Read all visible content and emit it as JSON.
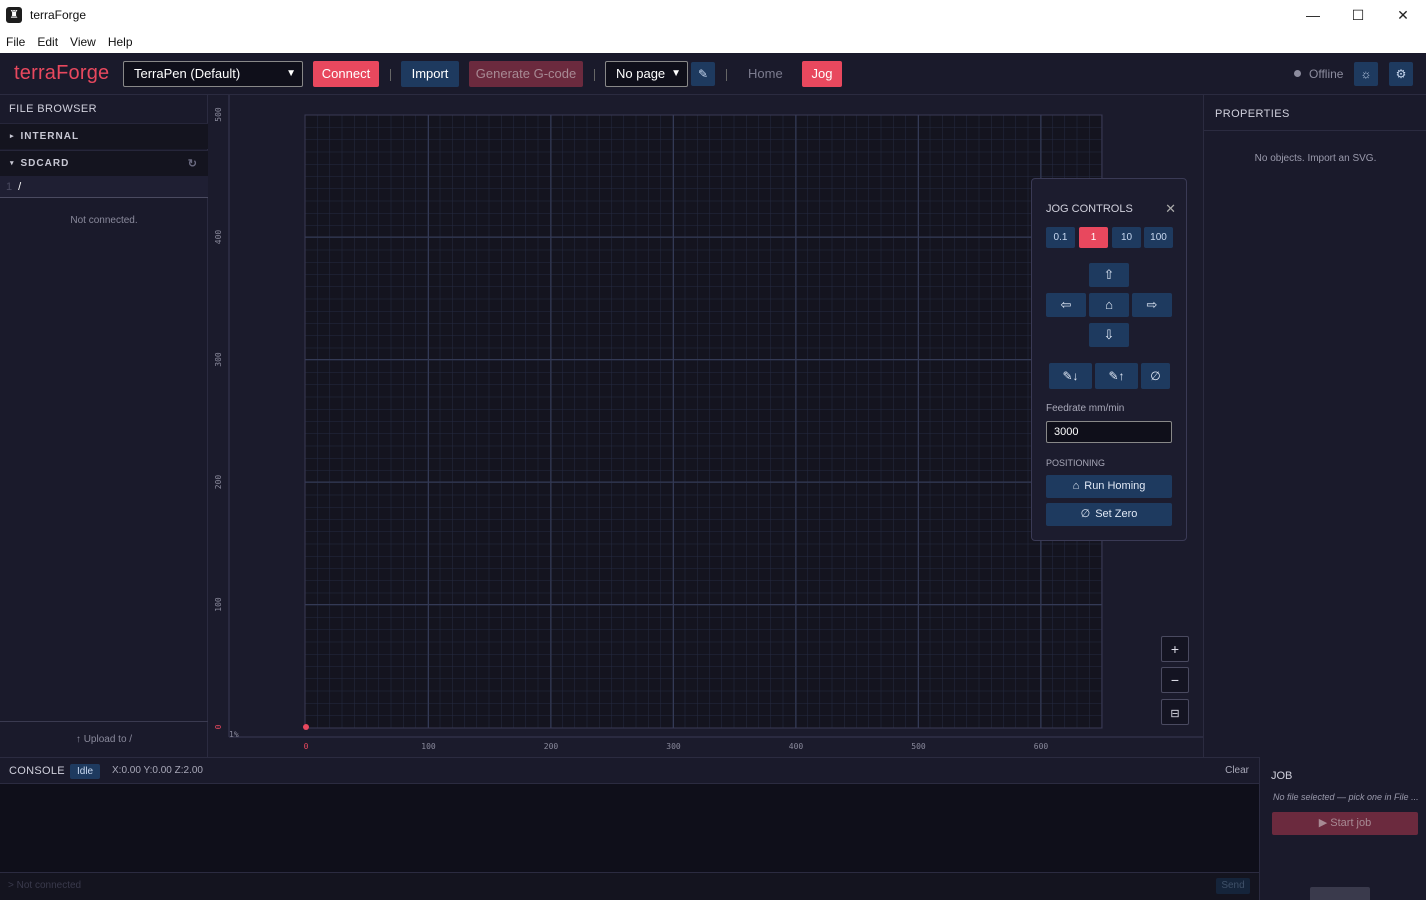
{
  "window": {
    "title": "terraForge",
    "minimize": "—",
    "maximize": "☐",
    "close": "✕"
  },
  "menu": [
    "File",
    "Edit",
    "View",
    "Help"
  ],
  "toolbar": {
    "logo": "terraForge",
    "machine_select": "TerraPen (Default)",
    "connect": "Connect",
    "import": "Import",
    "generate": "Generate G-code",
    "page_select": "No page",
    "home": "Home",
    "jog": "Jog",
    "status": "Offline"
  },
  "file_browser": {
    "title": "FILE BROWSER",
    "internal": "INTERNAL",
    "sdcard": "SDCARD",
    "path_index": "1",
    "path": "/",
    "empty": "Not connected.",
    "upload": "↑ Upload to /"
  },
  "canvas": {
    "x_ticks": [
      "0",
      "100",
      "200",
      "300",
      "400",
      "500",
      "600"
    ],
    "y_ticks": [
      "500",
      "400",
      "300",
      "200",
      "100",
      "0"
    ],
    "zoom_label": "1%"
  },
  "properties": {
    "title": "PROPERTIES",
    "empty": "No objects. Import an SVG."
  },
  "jog": {
    "title": "JOG CONTROLS",
    "steps": [
      "0.1",
      "1",
      "10",
      "100"
    ],
    "active_step": "1",
    "feedrate_label": "Feedrate mm/min",
    "feedrate": "3000",
    "positioning_label": "POSITIONING",
    "run_homing": "Run Homing",
    "set_zero": "Set Zero"
  },
  "console": {
    "title": "CONSOLE",
    "state": "Idle",
    "coords": "X:0.00 Y:0.00 Z:2.00",
    "clear": "Clear",
    "input_placeholder": "> Not connected",
    "send": "Send"
  },
  "job": {
    "title": "JOB",
    "no_file": "No file selected — pick one in File ...",
    "start": "▶ Start job"
  },
  "colors": {
    "accent": "#e8485e",
    "button_blue": "#1e3a5f",
    "bg": "#1b1b2c"
  }
}
